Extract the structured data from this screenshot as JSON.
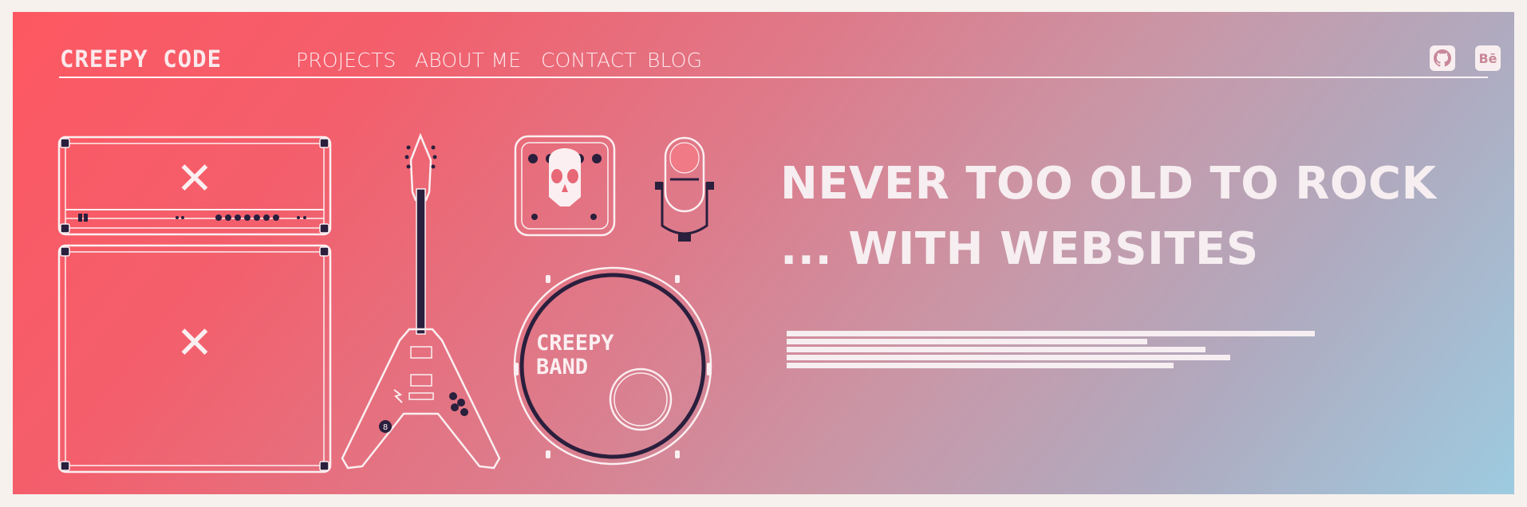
{
  "header": {
    "logo": "CREEPY CODE",
    "nav": [
      "PROJECTS",
      "ABOUT ME",
      "CONTACT",
      "BLOG"
    ],
    "social": [
      {
        "name": "github-icon",
        "glyph": "GH"
      },
      {
        "name": "behance-icon",
        "glyph": "Bē"
      }
    ]
  },
  "hero": {
    "headline_line1": "NEVER TOO OLD TO ROCK",
    "headline_line2": "... WITH WEBSITES",
    "drum_text_line1": "CREEPY",
    "drum_text_line2": "BAND",
    "amp_mark": "✕"
  },
  "colors": {
    "gradient_start": "#fd5862",
    "gradient_end": "#9dcbe0",
    "ink": "#2a1f3d",
    "line": "#fbeff1"
  }
}
